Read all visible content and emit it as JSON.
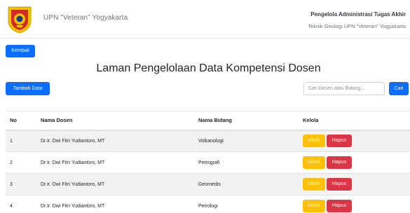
{
  "header": {
    "university": "UPN \"Veteran\" Yogyakarta",
    "role": "Pengelola Administrasi Tugas Akhir",
    "department": "Teknik Geologi UPN \"Veteran\" Yogyakarta"
  },
  "back_label": "Kembali",
  "page_title": "Laman Pengelolaan Data Kompetensi Dosen",
  "add_label": "Tambah Data",
  "search": {
    "placeholder": "Cari Dosen atau Bidang...",
    "button_label": "Cari"
  },
  "table": {
    "headers": {
      "no": "No",
      "name": "Nama Dosen",
      "field": "Nama Bidang",
      "actions": "Kelola"
    },
    "rows": [
      {
        "no": "1",
        "name": "Dr.Ir. Dwi Fitri Yudiantoro, MT",
        "field": "Volkanologi",
        "edit": "Ubah",
        "delete": "Hapus"
      },
      {
        "no": "2",
        "name": "Dr.Ir. Dwi Fitri Yudiantoro, MT",
        "field": "Petrografi",
        "edit": "Ubah",
        "delete": "Hapus"
      },
      {
        "no": "3",
        "name": "Dr.Ir. Dwi Fitri Yudiantoro, MT",
        "field": "Geomedis",
        "edit": "Ubah",
        "delete": "Hapus"
      },
      {
        "no": "4",
        "name": "Dr.Ir. Dwi Fitri Yudiantoro, MT",
        "field": "Petrologi",
        "edit": "Ubah",
        "delete": "Hapus"
      }
    ]
  },
  "colors": {
    "primary": "#0d6efd",
    "warning": "#ffc107",
    "danger": "#dc3545"
  },
  "icons": {
    "logo": "university-emblem-icon"
  }
}
